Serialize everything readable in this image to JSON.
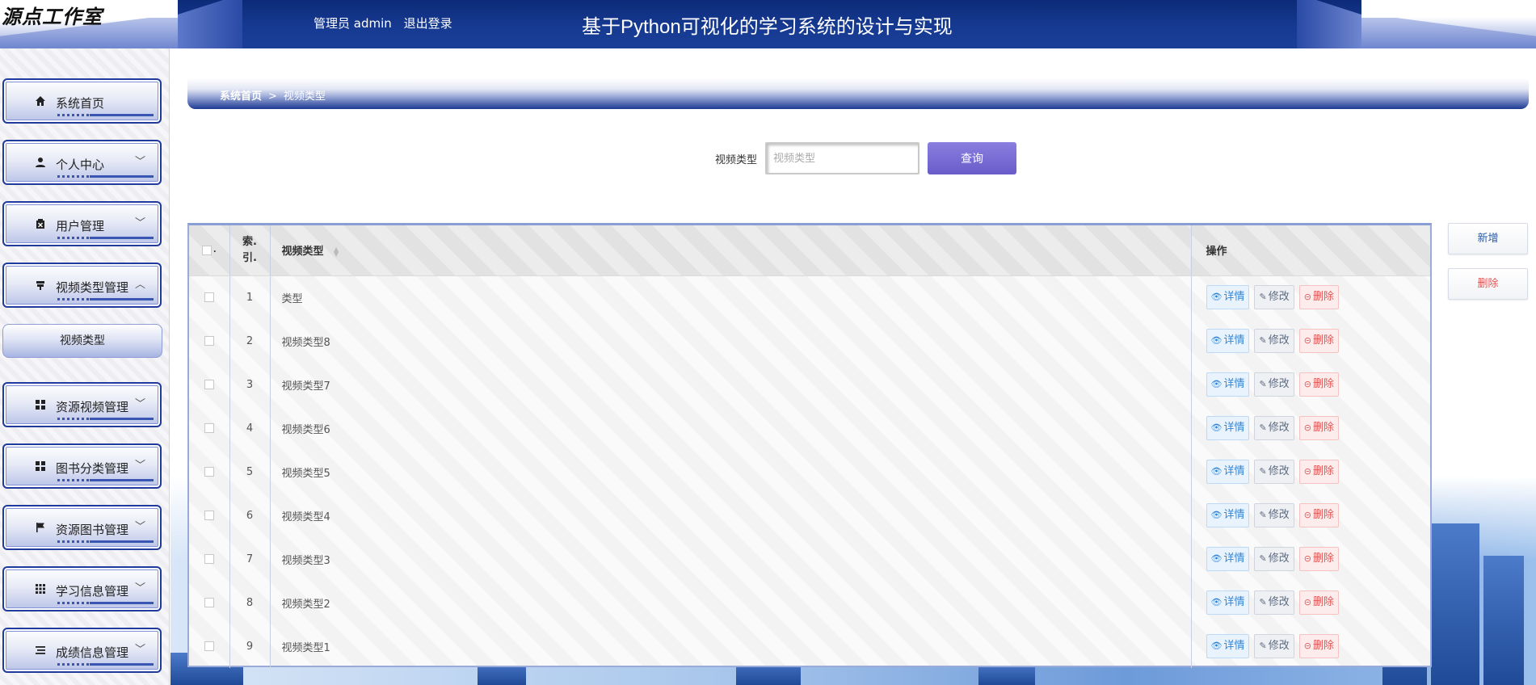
{
  "header": {
    "logo": "源点工作室",
    "role_label": "管理员 admin",
    "logout_label": "退出登录",
    "system_title": "基于Python可视化的学习系统的设计与实现"
  },
  "sidebar": {
    "items": [
      {
        "label": "系统首页",
        "icon": "home-icon"
      },
      {
        "label": "个人中心",
        "icon": "user-icon",
        "chevron": "﹀"
      },
      {
        "label": "用户管理",
        "icon": "user-manage-icon",
        "chevron": "﹀"
      },
      {
        "label": "视频类型管理",
        "icon": "video-type-icon",
        "chevron": "︿"
      },
      {
        "label": "资源视频管理",
        "icon": "grid-icon",
        "chevron": "﹀"
      },
      {
        "label": "图书分类管理",
        "icon": "grid-icon",
        "chevron": "﹀"
      },
      {
        "label": "资源图书管理",
        "icon": "flag-icon",
        "chevron": "﹀"
      },
      {
        "label": "学习信息管理",
        "icon": "apps-icon",
        "chevron": "﹀"
      },
      {
        "label": "成绩信息管理",
        "icon": "list-icon",
        "chevron": "﹀"
      }
    ],
    "submenu": {
      "label": "视频类型"
    }
  },
  "breadcrumb": {
    "home": "系统首页",
    "separator": ">",
    "current": "视频类型"
  },
  "search": {
    "label": "视频类型",
    "placeholder": "视频类型",
    "button": "查询"
  },
  "actions": {
    "add": "新增",
    "delete": "删除"
  },
  "table": {
    "headers": {
      "check_dot": ".",
      "index": "索.\n引.",
      "type": "视频类型",
      "operation": "操作"
    },
    "row_buttons": {
      "detail": "详情",
      "edit": "修改",
      "delete": "删除"
    },
    "rows": [
      {
        "index": "1",
        "type": "类型"
      },
      {
        "index": "2",
        "type": "视频类型8"
      },
      {
        "index": "3",
        "type": "视频类型7"
      },
      {
        "index": "4",
        "type": "视频类型6"
      },
      {
        "index": "5",
        "type": "视频类型5"
      },
      {
        "index": "6",
        "type": "视频类型4"
      },
      {
        "index": "7",
        "type": "视频类型3"
      },
      {
        "index": "8",
        "type": "视频类型2"
      },
      {
        "index": "9",
        "type": "视频类型1"
      }
    ]
  },
  "colors": {
    "header_bg": "#163a91",
    "search_button": "#6a5cc9",
    "detail_text": "#2f86d8",
    "delete_text": "#e25454"
  }
}
